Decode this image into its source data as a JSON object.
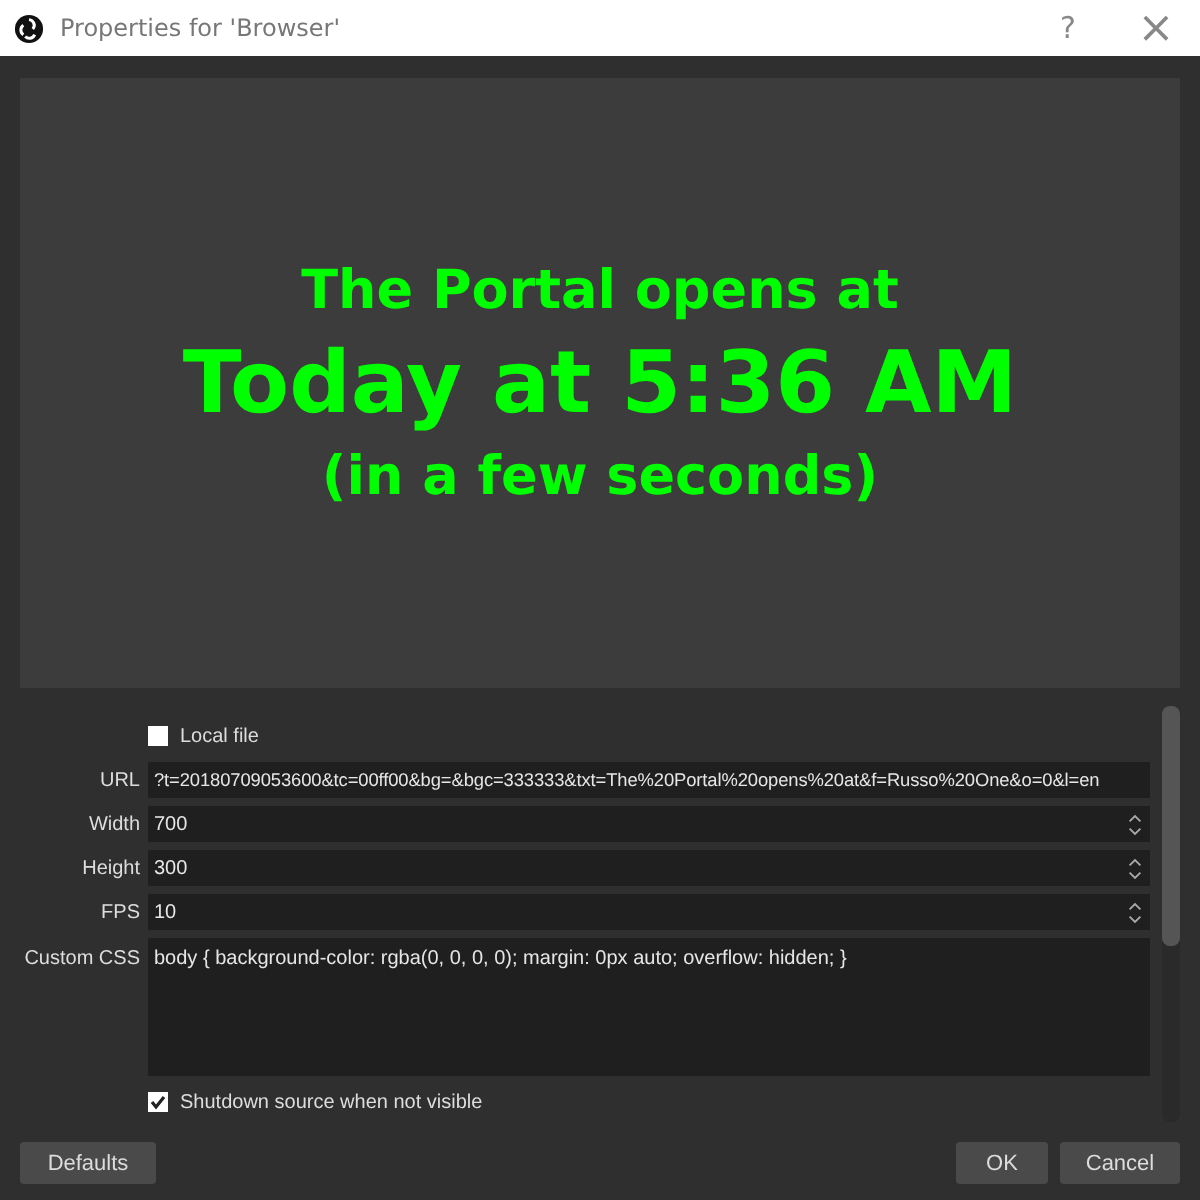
{
  "window": {
    "title": "Properties for 'Browser'",
    "help": "?",
    "close": "×"
  },
  "preview": {
    "lines": [
      {
        "kind": "medium",
        "text": "The Portal opens at"
      },
      {
        "kind": "large",
        "text": "Today at 5:36 AM"
      },
      {
        "kind": "medium",
        "text": "(in a few seconds)"
      }
    ]
  },
  "fields": [
    {
      "kind": "checkbox",
      "label": "Local file",
      "checked": false
    },
    {
      "kind": "text",
      "label": "URL",
      "value": "?t=20180709053600&tc=00ff00&bg=&bgc=333333&txt=The%20Portal%20opens%20at&f=Russo%20One&o=0&l=en"
    },
    {
      "kind": "spin",
      "label": "Width",
      "value": "700"
    },
    {
      "kind": "spin",
      "label": "Height",
      "value": "300"
    },
    {
      "kind": "spin",
      "label": "FPS",
      "value": "10"
    },
    {
      "kind": "textarea",
      "label": "Custom CSS",
      "value": "body { background-color: rgba(0, 0, 0, 0); margin: 0px auto; overflow: hidden; }"
    },
    {
      "kind": "checkbox",
      "label": "Shutdown source when not visible",
      "checked": true
    }
  ],
  "buttons": {
    "left": [
      "Defaults"
    ],
    "right": [
      "OK",
      "Cancel"
    ]
  }
}
